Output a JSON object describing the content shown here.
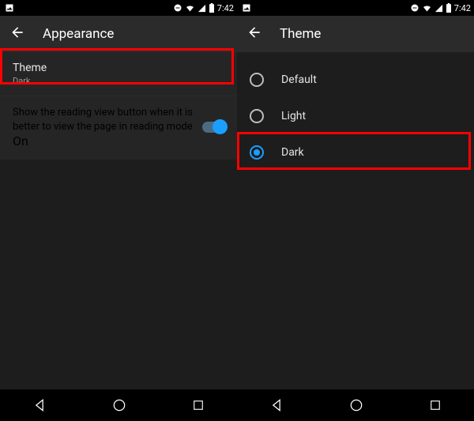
{
  "status": {
    "time": "7:42"
  },
  "left": {
    "title": "Appearance",
    "theme_item": {
      "label": "Theme",
      "value": "Dark"
    },
    "reading_item": {
      "label": "Show the reading view button when it is better to view the page in reading mode",
      "value": "On"
    }
  },
  "right": {
    "title": "Theme",
    "options": {
      "0": {
        "label": "Default"
      },
      "1": {
        "label": "Light"
      },
      "2": {
        "label": "Dark"
      }
    },
    "selected": "Dark"
  }
}
